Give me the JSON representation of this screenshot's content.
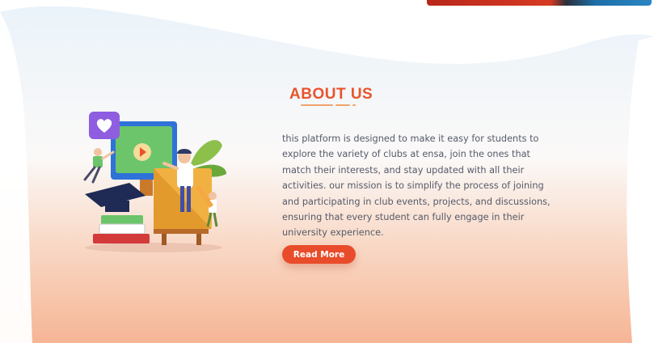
{
  "about": {
    "title": "ABOUT US",
    "description": "this platform is designed to make it easy for students to explore the variety of clubs at ensa, join the ones that match their interests, and stay updated with all their activities. our mission is to simplify the process of joining and participating in club events, projects, and discussions, ensuring that every student can fully engage in their university experience.",
    "read_more_label": "Read More"
  },
  "illustration": {
    "icons": [
      "heart-icon",
      "play-icon"
    ]
  },
  "colors": {
    "accent": "#e8542c",
    "button": "#e84c2a",
    "text": "#555a6a",
    "bg_top": "#eef5fb",
    "bg_bottom": "#f6bb9c"
  }
}
